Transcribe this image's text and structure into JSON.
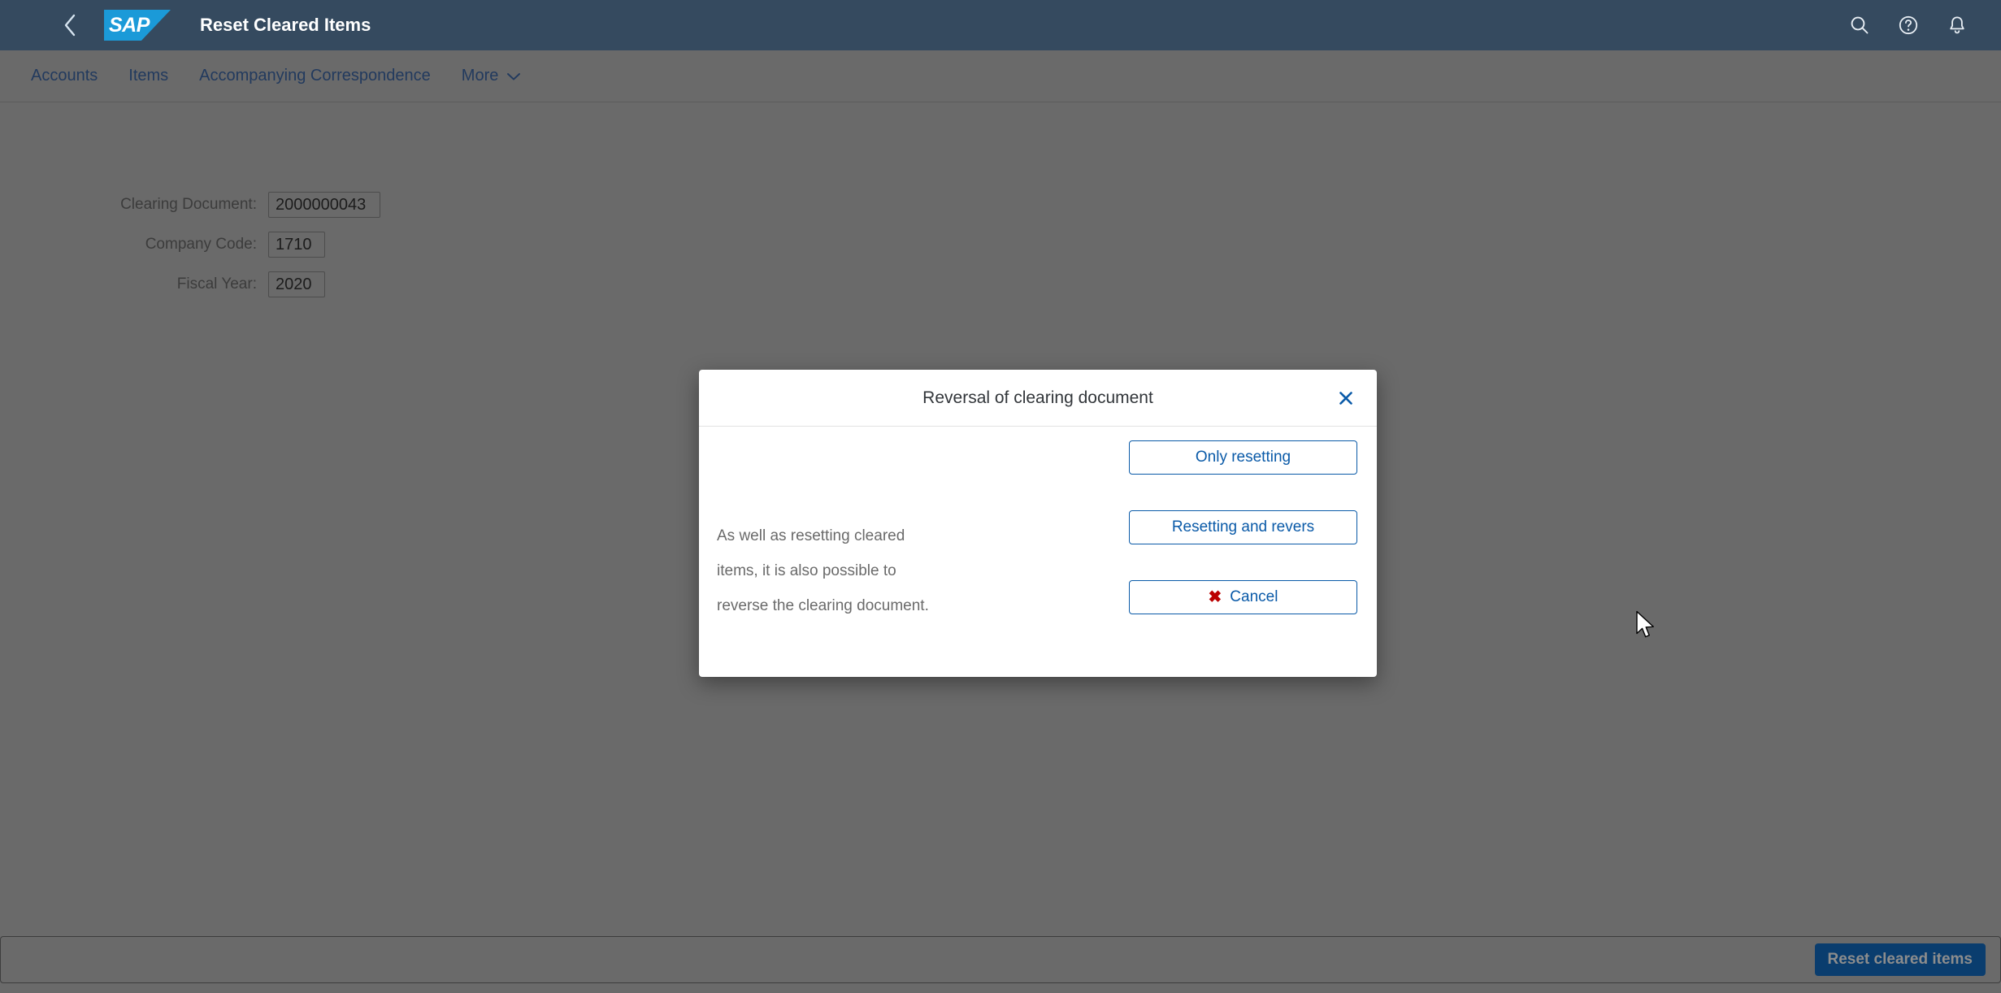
{
  "header": {
    "back_icon": "chevron-left-icon",
    "logo_text": "SAP",
    "title": "Reset Cleared Items",
    "actions": [
      {
        "name": "search-icon",
        "label": "Search"
      },
      {
        "name": "help-icon",
        "label": "Help"
      },
      {
        "name": "notifications-bell-icon",
        "label": "Notifications"
      }
    ]
  },
  "subnav": {
    "items": [
      {
        "label": "Accounts",
        "has_chevron": false
      },
      {
        "label": "Items",
        "has_chevron": false
      },
      {
        "label": "Accompanying Correspondence",
        "has_chevron": false
      },
      {
        "label": "More",
        "has_chevron": true
      }
    ]
  },
  "form": {
    "fields": [
      {
        "label": "Clearing Document:",
        "value": "2000000043",
        "placeholder": ""
      },
      {
        "label": "Company Code:",
        "value": "1710",
        "placeholder": ""
      },
      {
        "label": "Fiscal Year:",
        "value": "2020",
        "placeholder": ""
      }
    ]
  },
  "footer": {
    "primary_label": "Reset cleared items"
  },
  "dialog": {
    "title": "Reversal of clearing document",
    "close_icon": "close-icon",
    "message_lines": [
      "As well as resetting cleared",
      "items, it is also possible to",
      "reverse the clearing document."
    ],
    "buttons": [
      {
        "label": "Only resetting",
        "icon": null
      },
      {
        "label": "Resetting and revers",
        "icon": null
      },
      {
        "label": "Cancel",
        "icon": "cancel-x-icon",
        "icon_glyph": "✖"
      }
    ]
  },
  "colors": {
    "shell_header_bg": "#354a5f",
    "overlay_bg": "#6a6a6a",
    "logo_blue": "#1b9ad8",
    "accent_blue": "#0a5aa8",
    "footer_button_bg": "#0a3d6e",
    "cancel_red": "#bb0000",
    "subnav_text": "#223a5e"
  }
}
